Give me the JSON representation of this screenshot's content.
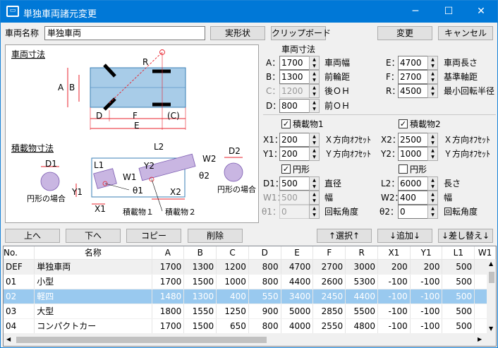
{
  "window": {
    "title": "単独車両諸元変更",
    "icon": "car-window-icon",
    "min": "─",
    "max": "☐",
    "close": "✕"
  },
  "top": {
    "name_label": "車両名称",
    "name_value": "単独車両",
    "btn_real": "実形状",
    "btn_clip": "クリップボード",
    "btn_change": "変更",
    "btn_cancel": "キャンセル"
  },
  "diagram": {
    "section1": "車両寸法",
    "section2": "積載物寸法",
    "labels": {
      "A": "A",
      "B": "B",
      "C": "(C)",
      "D": "D",
      "E": "E",
      "F": "F",
      "R": "R",
      "L1": "L1",
      "L2": "L2",
      "W1": "W1",
      "W2": "W2",
      "X1": "X1",
      "X2": "X2",
      "Y1": "Y1",
      "Y2": "Y2",
      "D1": "D1",
      "D2": "D2",
      "t1": "θ1",
      "t2": "θ2",
      "load1": "積載物１",
      "load2": "積載物２",
      "circ1": "円形の場合",
      "circ2": "円形の場合"
    }
  },
  "dims": {
    "header": "車両寸法",
    "A": {
      "key": "A：",
      "value": "1700",
      "label": "車両幅"
    },
    "B": {
      "key": "B：",
      "value": "1300",
      "label": "前輪距"
    },
    "C": {
      "key": "C：",
      "value": "1200",
      "label": "後ＯＨ"
    },
    "D": {
      "key": "D：",
      "value": "800",
      "label": "前ＯＨ"
    },
    "E": {
      "key": "E：",
      "value": "4700",
      "label": "車両長さ"
    },
    "F": {
      "key": "F：",
      "value": "2700",
      "label": "基準軸距"
    },
    "R": {
      "key": "R：",
      "value": "4500",
      "label": "最小回転半径"
    }
  },
  "load1": {
    "check_label": "積載物1",
    "circle_label": "円形",
    "X1": {
      "key": "X1：",
      "value": "200",
      "label": "Ｘ方向ｵﾌｾｯﾄ"
    },
    "Y1": {
      "key": "Y1：",
      "value": "200",
      "label": "Ｙ方向ｵﾌｾｯﾄ"
    },
    "D1": {
      "key": "D1：",
      "value": "500",
      "label": "直径"
    },
    "W1": {
      "key": "W1：",
      "value": "500",
      "label": "幅"
    },
    "T1": {
      "key": "θ1：",
      "value": "0",
      "label": "回転角度"
    }
  },
  "load2": {
    "check_label": "積載物2",
    "circle_label": "円形",
    "X2": {
      "key": "X2：",
      "value": "2500",
      "label": "Ｘ方向ｵﾌｾｯﾄ"
    },
    "Y2": {
      "key": "Y2：",
      "value": "1000",
      "label": "Ｙ方向ｵﾌｾｯﾄ"
    },
    "L2": {
      "key": "L2：",
      "value": "6000",
      "label": "長さ"
    },
    "W2": {
      "key": "W2：",
      "value": "400",
      "label": "幅"
    },
    "T2": {
      "key": "θ2：",
      "value": "0",
      "label": "回転角度"
    }
  },
  "toolbar": {
    "up": "上へ",
    "down": "下へ",
    "copy": "コピー",
    "delete": "削除",
    "select": "↑選択↑",
    "add": "↓追加↓",
    "replace": "↓差し替え↓"
  },
  "table": {
    "columns": [
      "No.",
      "名称",
      "A",
      "B",
      "C",
      "D",
      "E",
      "F",
      "R",
      "X1",
      "Y1",
      "L1",
      "W1"
    ],
    "rows": [
      [
        "DEF",
        "単独車両",
        "1700",
        "1300",
        "1200",
        "800",
        "4700",
        "2700",
        "3000",
        "200",
        "200",
        "500",
        ""
      ],
      [
        "01",
        "小型",
        "1700",
        "1500",
        "1000",
        "800",
        "4400",
        "2600",
        "5300",
        "-100",
        "-100",
        "500",
        ""
      ],
      [
        "02",
        "軽四",
        "1480",
        "1300",
        "400",
        "550",
        "3400",
        "2450",
        "4400",
        "-100",
        "-100",
        "500",
        ""
      ],
      [
        "03",
        "大型",
        "1800",
        "1550",
        "1250",
        "900",
        "5000",
        "2850",
        "5500",
        "-100",
        "-100",
        "500",
        ""
      ],
      [
        "04",
        "コンパクトカー",
        "1700",
        "1500",
        "650",
        "800",
        "4000",
        "2550",
        "4800",
        "-100",
        "-100",
        "500",
        ""
      ]
    ]
  },
  "colors": {
    "titlebar": "#0078d7",
    "dim": "#e8212b",
    "vehicle": "#a8cce8",
    "load": "#c9b6e2",
    "selected_row": "#99c9ef"
  }
}
